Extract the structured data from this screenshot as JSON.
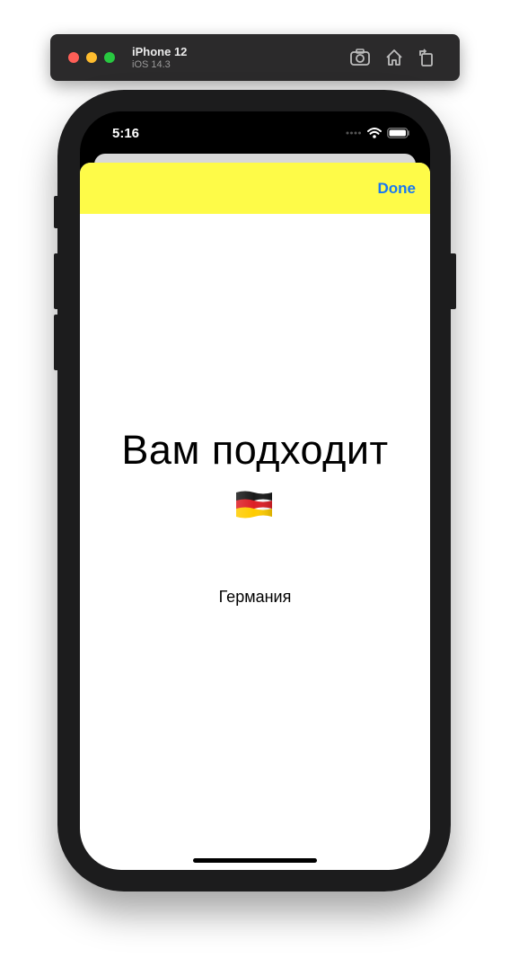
{
  "simulator": {
    "device_name": "iPhone 12",
    "os_version": "iOS 14.3",
    "toolbar_icons": [
      "screenshot-icon",
      "home-icon",
      "rotate-icon"
    ]
  },
  "status_bar": {
    "time": "5:16",
    "icons": [
      "signal-icon",
      "wifi-icon",
      "battery-icon"
    ]
  },
  "nav": {
    "done_label": "Done",
    "background": "#fefb48",
    "accent": "#1877f2"
  },
  "content": {
    "headline": "Вам подходит",
    "flag_icon": "germany-flag-icon",
    "country": "Германия"
  }
}
